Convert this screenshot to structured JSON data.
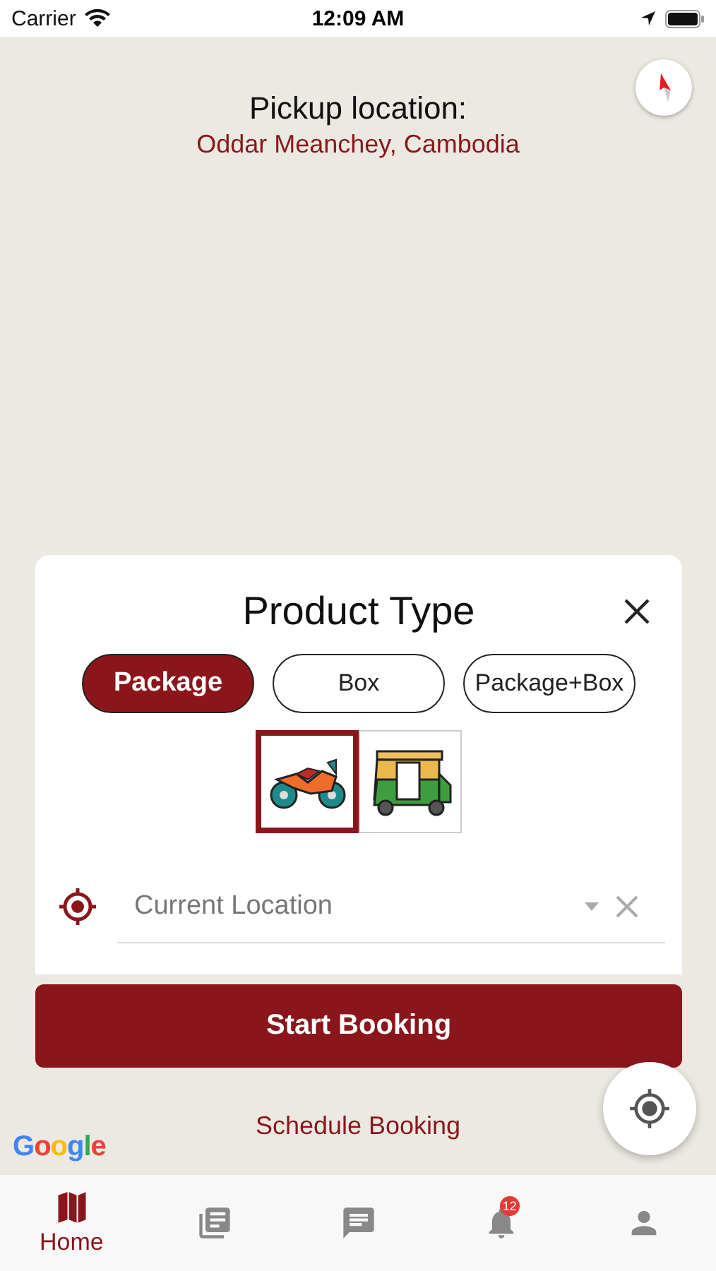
{
  "status_bar": {
    "carrier": "Carrier",
    "time": "12:09 AM"
  },
  "pickup": {
    "label": "Pickup location:",
    "place": "Oddar Meanchey, Cambodia"
  },
  "product_sheet": {
    "title": "Product Type",
    "types": [
      {
        "label": "Package",
        "selected": true
      },
      {
        "label": "Box",
        "selected": false
      },
      {
        "label": "Package+Box",
        "selected": false
      }
    ],
    "vehicles": [
      {
        "kind": "motorbike",
        "selected": true
      },
      {
        "kind": "tuktuk",
        "selected": false
      }
    ],
    "location": {
      "placeholder": "Current Location"
    }
  },
  "start_button": "Start Booking",
  "schedule_link": "Schedule Booking",
  "map_logo": "Google",
  "nav": [
    {
      "kind": "map",
      "label": "Home",
      "selected": true
    },
    {
      "kind": "news",
      "selected": false
    },
    {
      "kind": "chat",
      "selected": false
    },
    {
      "kind": "bell",
      "badge": "12",
      "selected": false
    },
    {
      "kind": "person",
      "selected": false
    }
  ]
}
